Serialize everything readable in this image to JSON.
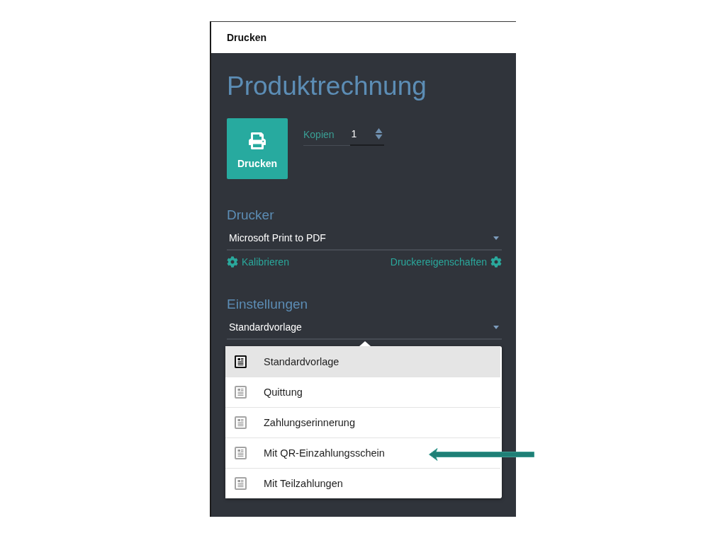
{
  "window": {
    "title": "Drucken"
  },
  "document": {
    "title": "Produktrechnung"
  },
  "print_button": {
    "label": "Drucken"
  },
  "copies": {
    "label": "Kopien",
    "value": "1"
  },
  "printer": {
    "heading": "Drucker",
    "value": "Microsoft Print to PDF",
    "calibrate_link": "Kalibrieren",
    "properties_link": "Druckereigenschaften"
  },
  "settings": {
    "heading": "Einstellungen",
    "value": "Standardvorlage",
    "expanded": true,
    "options": [
      {
        "label": "Standardvorlage",
        "selected": true
      },
      {
        "label": "Quittung",
        "selected": false
      },
      {
        "label": "Zahlungserinnerung",
        "selected": false
      },
      {
        "label": "Mit QR-Einzahlungsschein",
        "selected": false
      },
      {
        "label": "Mit Teilzahlungen",
        "selected": false
      }
    ]
  }
}
